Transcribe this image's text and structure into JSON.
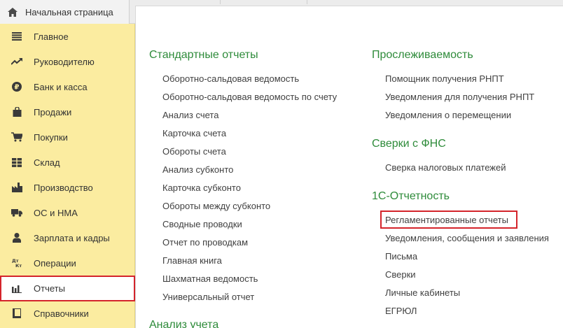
{
  "tabs": {
    "home_label": "Начальная страница",
    "home_icon": "home-icon"
  },
  "sidebar": {
    "items": [
      {
        "label": "Главное",
        "icon": "menu-lines-icon"
      },
      {
        "label": "Руководителю",
        "icon": "trend-chart-icon"
      },
      {
        "label": "Банк и касса",
        "icon": "ruble-coin-icon"
      },
      {
        "label": "Продажи",
        "icon": "shopping-bag-icon"
      },
      {
        "label": "Покупки",
        "icon": "shopping-cart-icon"
      },
      {
        "label": "Склад",
        "icon": "warehouse-grid-icon"
      },
      {
        "label": "Производство",
        "icon": "factory-icon"
      },
      {
        "label": "ОС и НМА",
        "icon": "truck-icon"
      },
      {
        "label": "Зарплата и кадры",
        "icon": "person-icon"
      },
      {
        "label": "Операции",
        "icon": "debit-credit-icon",
        "icon_text_top": "Дт",
        "icon_text_bottom": "Кт"
      },
      {
        "label": "Отчеты",
        "icon": "bar-chart-icon",
        "selected": true
      },
      {
        "label": "Справочники",
        "icon": "book-icon"
      }
    ]
  },
  "left_column": {
    "section1_title": "Стандартные отчеты",
    "links": [
      "Оборотно-сальдовая ведомость",
      "Оборотно-сальдовая ведомость по счету",
      "Анализ счета",
      "Карточка счета",
      "Обороты счета",
      "Анализ субконто",
      "Карточка субконто",
      "Обороты между субконто",
      "Сводные проводки",
      "Отчет по проводкам",
      "Главная книга",
      "Шахматная ведомость",
      "Универсальный отчет"
    ],
    "section2_title": "Анализ учета"
  },
  "right_column": {
    "traceability_title": "Прослеживаемость",
    "traceability_links": [
      "Помощник получения РНПТ",
      "Уведомления для получения РНПТ",
      "Уведомления о перемещении"
    ],
    "fns_title": "Сверки с ФНС",
    "fns_links": [
      "Сверка налоговых платежей"
    ],
    "reporting_title": "1С-Отчетность",
    "reporting_links": [
      "Регламентированные отчеты",
      "Уведомления, сообщения и заявления",
      "Письма",
      "Сверки",
      "Личные кабинеты",
      "ЕГРЮЛ"
    ]
  },
  "colors": {
    "sidebar_bg": "#fbeca0",
    "section_title": "#2e8b3a",
    "highlight": "#d4242b"
  }
}
